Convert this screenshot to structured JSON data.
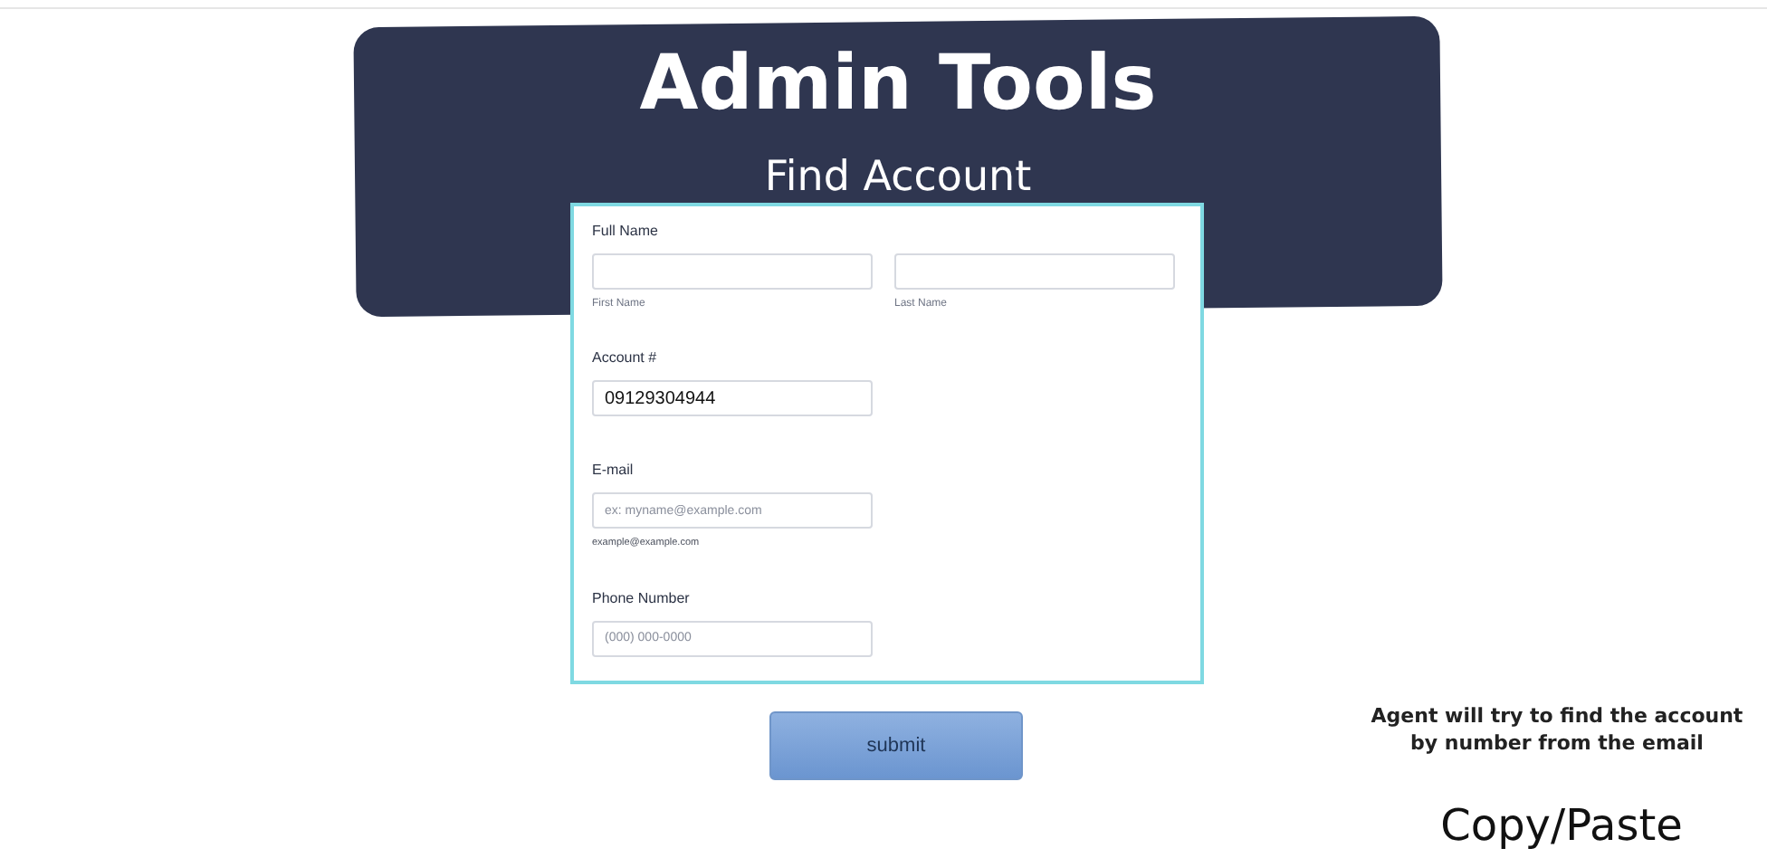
{
  "banner": {
    "title": "Admin Tools",
    "subtitle": "Find Account"
  },
  "form": {
    "full_name": {
      "label": "Full Name",
      "first": {
        "sublabel": "First Name"
      },
      "last": {
        "sublabel": "Last Name"
      }
    },
    "account": {
      "label": "Account #",
      "value": "09129304944"
    },
    "email": {
      "label": "E-mail",
      "placeholder": "ex: myname@example.com",
      "hint": "example@example.com"
    },
    "phone": {
      "label": "Phone Number",
      "placeholder": "(000) 000-0000"
    },
    "submit": "submit"
  },
  "note": "Agent will try to find the account by number from the email",
  "caption": "Copy/Paste"
}
